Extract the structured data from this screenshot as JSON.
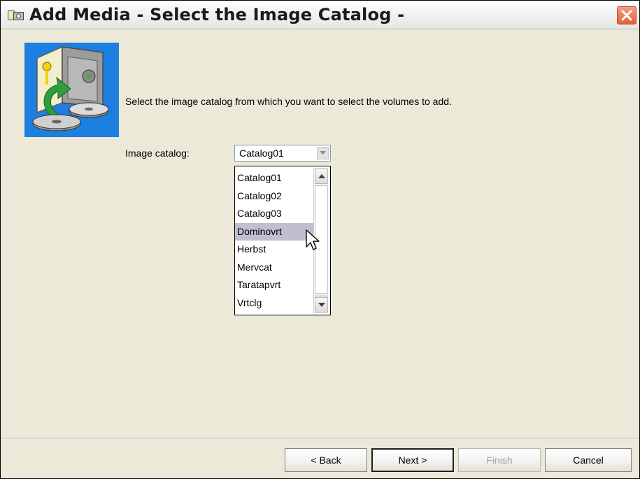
{
  "window": {
    "title": "Add Media - Select the Image Catalog -"
  },
  "icons": {
    "title": "window-icon",
    "close": "close-icon",
    "wizard": "vault-disc-icon",
    "cursor": "mouse-pointer-icon"
  },
  "instruction": "Select the image catalog from which you want to select the volumes to add.",
  "catalog": {
    "label": "Image catalog:",
    "selected": "Catalog01",
    "options": [
      "Catalog01",
      "Catalog02",
      "Catalog03",
      "Dominovrt",
      "Herbst",
      "Mervcat",
      "Taratapvrt",
      "Vrtclg"
    ],
    "highlighted": "Dominovrt"
  },
  "buttons": {
    "back": "< Back",
    "next": "Next >",
    "finish": "Finish",
    "cancel": "Cancel"
  },
  "colors": {
    "close_red": "#e2603a",
    "highlight": "#bfbfcf",
    "icon_blue": "#1d7fe0"
  }
}
